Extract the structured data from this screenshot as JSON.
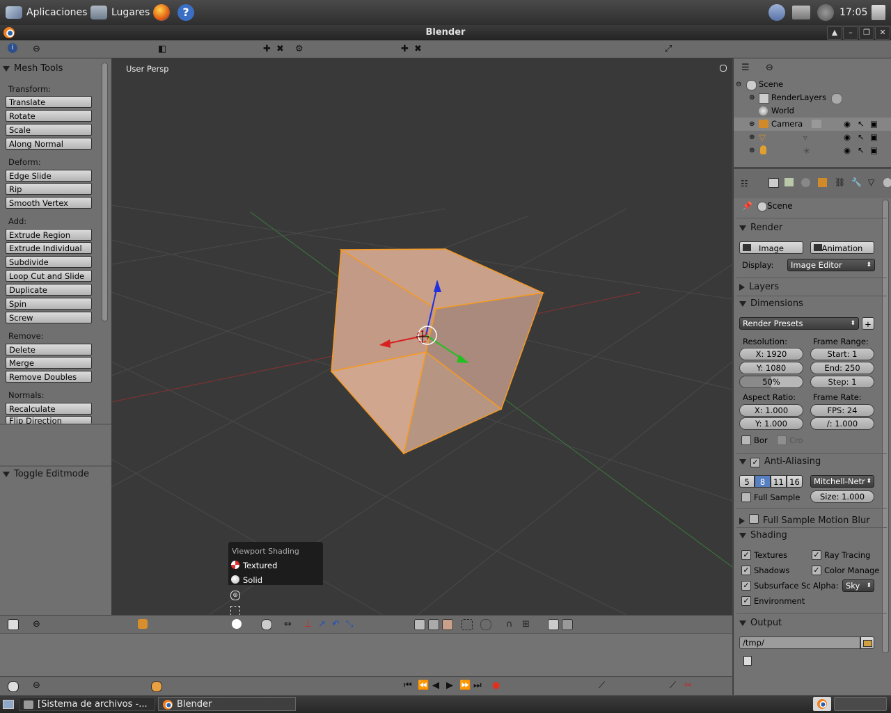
{
  "gnome_panel": {
    "applications": "Aplicaciones",
    "places": "Lugares",
    "clock": "17:05"
  },
  "window": {
    "title": "Blender"
  },
  "viewport": {
    "view_label": "User Persp"
  },
  "tool_shelf": {
    "panel_title": "Mesh Tools",
    "groups": [
      {
        "label": "Transform:",
        "buttons": [
          "Translate",
          "Rotate",
          "Scale",
          "Along Normal"
        ]
      },
      {
        "label": "Deform:",
        "buttons": [
          "Edge Slide",
          "Rip",
          "Smooth Vertex"
        ]
      },
      {
        "label": "Add:",
        "buttons": [
          "Extrude Region",
          "Extrude Individual",
          "Subdivide",
          "Loop Cut and Slide",
          "Duplicate",
          "Spin",
          "Screw"
        ]
      },
      {
        "label": "Remove:",
        "buttons": [
          "Delete",
          "Merge",
          "Remove Doubles"
        ]
      },
      {
        "label": "Normals:",
        "buttons": [
          "Recalculate",
          "Flip Direction"
        ]
      }
    ],
    "operator_panel": "Toggle Editmode"
  },
  "shading_menu": {
    "title": "Viewport Shading",
    "options": [
      "Textured",
      "Solid"
    ]
  },
  "outliner": {
    "rows": [
      {
        "label": "Scene"
      },
      {
        "label": "RenderLayers"
      },
      {
        "label": "World"
      },
      {
        "label": "Camera"
      },
      {
        "label": ""
      },
      {
        "label": ""
      }
    ]
  },
  "properties": {
    "context": "Scene",
    "render": {
      "title": "Render",
      "image_btn": "Image",
      "animation_btn": "Animation",
      "display_label": "Display:",
      "display_value": "Image Editor"
    },
    "layers_title": "Layers",
    "dimensions": {
      "title": "Dimensions",
      "presets": "Render Presets",
      "resolution_label": "Resolution:",
      "res_x": "X: 1920",
      "res_y": "Y: 1080",
      "res_pct": "50%",
      "frame_range_label": "Frame Range:",
      "start": "Start: 1",
      "end": "End: 250",
      "step": "Step: 1",
      "aspect_label": "Aspect Ratio:",
      "aspect_x": "X: 1.000",
      "aspect_y": "Y: 1.000",
      "frame_rate_label": "Frame Rate:",
      "fps": "FPS: 24",
      "fps_base": "/: 1.000",
      "border": "Bor",
      "crop": "Cro"
    },
    "anti_aliasing": {
      "title": "Anti-Aliasing",
      "samples": [
        "5",
        "8",
        "11",
        "16"
      ],
      "active_sample": "8",
      "filter": "Mitchell-Netr",
      "full_sample": "Full Sample",
      "size": "Size: 1.000"
    },
    "motion_blur_title": "Full Sample Motion Blur",
    "shading": {
      "title": "Shading",
      "textures": "Textures",
      "ray_tracing": "Ray Tracing",
      "shadows": "Shadows",
      "color_manage": "Color Manage",
      "subsurface": "Subsurface Sc",
      "alpha_label": "Alpha:",
      "alpha_value": "Sky",
      "environment": "Environment"
    },
    "output": {
      "title": "Output",
      "path": "/tmp/"
    }
  },
  "taskbar": {
    "items": [
      "[Sistema de archivos -...",
      "Blender"
    ]
  },
  "colors": {
    "viewport_bg": "#393939",
    "selection_orange": "#f5a623",
    "axis_x": "#d82020",
    "axis_y": "#20c020",
    "axis_z": "#2030e0"
  }
}
